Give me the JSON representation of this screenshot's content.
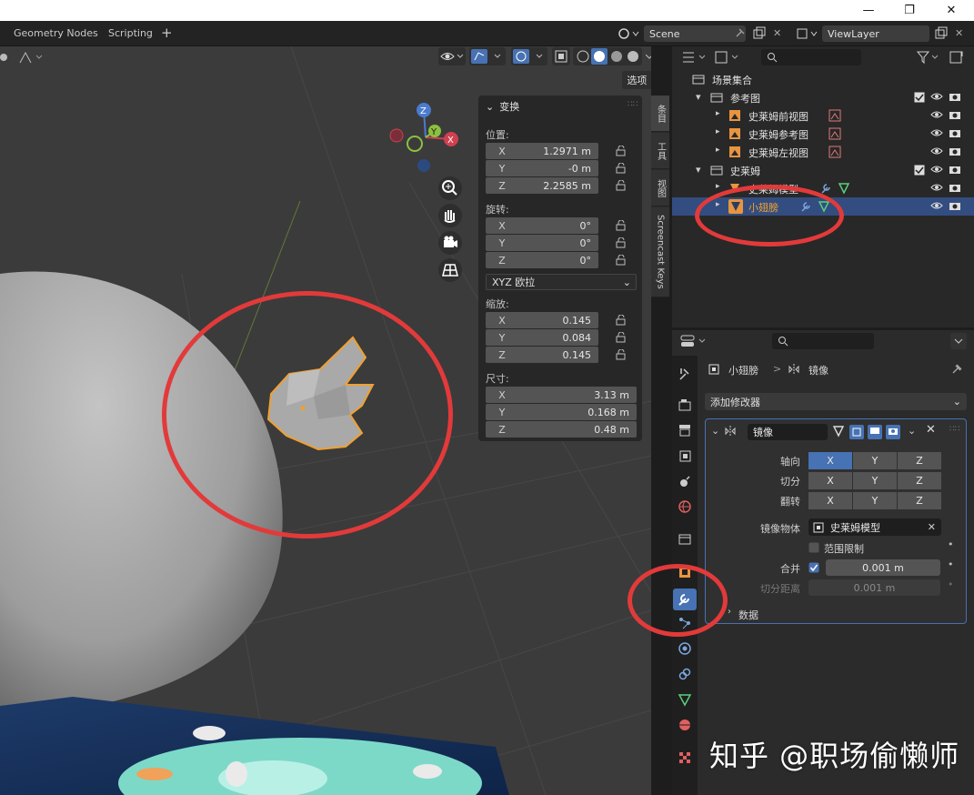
{
  "workspace_tabs": [
    "Geometry Nodes",
    "Scripting"
  ],
  "add_tab": "+",
  "scene": {
    "name": "Scene"
  },
  "view_layer": {
    "name": "ViewLayer"
  },
  "window_controls": {
    "minimize": "—",
    "maximize": "❐",
    "close": "✕"
  },
  "viewport": {
    "options_label": "选项"
  },
  "n_panel": {
    "header": "变换",
    "location_label": "位置:",
    "location": [
      {
        "axis": "X",
        "value": "1.2971 m"
      },
      {
        "axis": "Y",
        "value": "-0 m"
      },
      {
        "axis": "Z",
        "value": "2.2585 m"
      }
    ],
    "rotation_label": "旋转:",
    "rotation": [
      {
        "axis": "X",
        "value": "0°"
      },
      {
        "axis": "Y",
        "value": "0°"
      },
      {
        "axis": "Z",
        "value": "0°"
      }
    ],
    "rotation_mode": "XYZ 欧拉",
    "scale_label": "缩放:",
    "scale": [
      {
        "axis": "X",
        "value": "0.145"
      },
      {
        "axis": "Y",
        "value": "0.084"
      },
      {
        "axis": "Z",
        "value": "0.145"
      }
    ],
    "dimensions_label": "尺寸:",
    "dimensions": [
      {
        "axis": "X",
        "value": "3.13 m"
      },
      {
        "axis": "Y",
        "value": "0.168 m"
      },
      {
        "axis": "Z",
        "value": "0.48 m"
      }
    ]
  },
  "vertical_tabs": [
    "条目",
    "工具",
    "视图",
    "Screencast Keys"
  ],
  "outliner": {
    "rows": [
      {
        "label": "场景集合"
      },
      {
        "label": "参考图"
      },
      {
        "label": "史莱姆前视图"
      },
      {
        "label": "史莱姆参考图"
      },
      {
        "label": "史莱姆左视图"
      },
      {
        "label": "史莱姆"
      },
      {
        "label": "史莱姆模型"
      },
      {
        "label": "小翅膀"
      }
    ]
  },
  "properties": {
    "breadcrumb_object": "小翅膀",
    "breadcrumb_sep": ">",
    "breadcrumb_modifier": "镜像",
    "add_modifier": "添加修改器",
    "modifier_name": "镜像",
    "axis_label": "轴向",
    "bisect_label": "切分",
    "flip_label": "翻转",
    "axes": [
      "X",
      "Y",
      "Z"
    ],
    "mirror_object_label": "镜像物体",
    "mirror_object_value": "史莱姆模型",
    "clipping_label": "范围限制",
    "merge_label": "合并",
    "merge_value": "0.001 m",
    "bisect_distance_label": "切分距离",
    "bisect_distance_value": "0.001 m",
    "data_label": "数据"
  },
  "watermark": "知乎 @职场偷懒师",
  "colors": {
    "accent": "#4772b3",
    "selection": "#334d80",
    "annotation_red": "#e23a3a",
    "object_orange": "#f0a030"
  }
}
